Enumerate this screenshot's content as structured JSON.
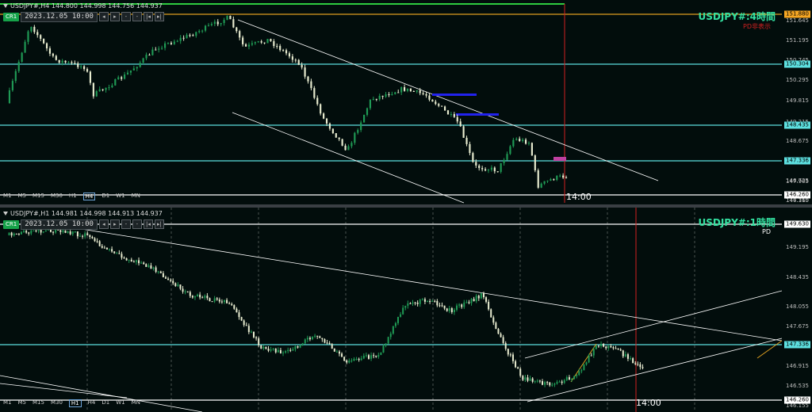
{
  "top": {
    "symbol": "USDJPY#,H4  144.800 144.998 144.756 144.937",
    "cr": "CR1",
    "date": "2023.12.05  10:00",
    "buttons": [
      "◂",
      "▸",
      "-",
      "-",
      "|◂",
      "▸|"
    ],
    "timeframes": [
      "M1",
      "M5",
      "M15",
      "M30",
      "H1",
      "H4",
      "D1",
      "W1",
      "MN"
    ],
    "active_tf": "H4",
    "title": "USDJPY#:4時間",
    "subtitle": "PD非表示",
    "time_label": "14:00",
    "ticks": [
      "151.645",
      "151.195",
      "150.745",
      "150.295",
      "149.815",
      "149.215",
      "148.675",
      "148.135",
      "147.905",
      "147.365",
      "146.725",
      "146.110"
    ],
    "tags": [
      {
        "text": "151.880",
        "bg": "#f5a623",
        "fg": "#000000"
      },
      {
        "text": "150.304",
        "bg": "#5de0e0",
        "fg": "#000000"
      },
      {
        "text": "148.435",
        "bg": "#5de0e0",
        "fg": "#000000"
      },
      {
        "text": "147.336",
        "bg": "#5de0e0",
        "fg": "#000000"
      },
      {
        "text": "146.260",
        "bg": "#ffffff",
        "fg": "#000000"
      }
    ]
  },
  "bottom": {
    "symbol": "USDJPY#,H1  144.981 144.998 144.913 144.937",
    "cr": "CR1",
    "date": "2023.12.05  10:00",
    "buttons": [
      "◂",
      "▸",
      "-",
      "-",
      "|◂",
      "▸|"
    ],
    "timeframes": [
      "M1",
      "M5",
      "M15",
      "M30",
      "H1",
      "H4",
      "D1",
      "W1",
      "MN"
    ],
    "active_tf": "H1",
    "title": "USDJPY#:1時間",
    "subtitle": "PD",
    "time_label": "14:00",
    "ticks": [
      "149.195",
      "148.435",
      "148.055",
      "147.675",
      "147.295",
      "146.915",
      "146.535",
      "146.155"
    ],
    "tags": [
      {
        "text": "149.630",
        "bg": "#ffffff",
        "fg": "#000000"
      },
      {
        "text": "147.336",
        "bg": "#5de0e0",
        "fg": "#000000"
      },
      {
        "text": "146.260",
        "bg": "#ffffff",
        "fg": "#000000"
      }
    ]
  },
  "colors": {
    "bull": "#1f9a55",
    "bear": "#e8ecd0",
    "hline": "#5de0e0",
    "orange": "#e0a020",
    "blue": "#2222ee",
    "magenta": "#c040a0",
    "vline": "#d02020"
  },
  "icons": {
    "collapse": "triangle-down-icon"
  }
}
